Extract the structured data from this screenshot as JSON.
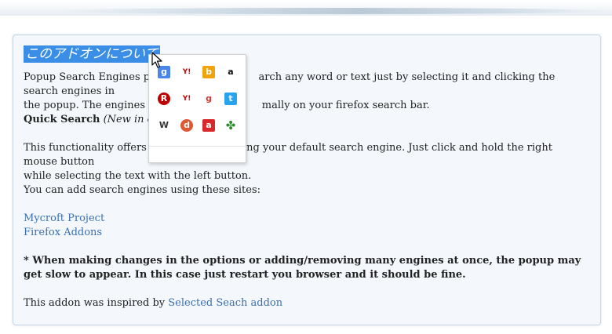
{
  "section_heading": "このアドオンについて",
  "intro_start": "Popup Search Engines prov",
  "intro_mid": "arch any word or text just by selecting it and clicking the search engines in",
  "intro_line2a": "the popup. The engines are",
  "intro_line2b": "mally on your firefox search bar.",
  "quick_search_label": "Quick Search",
  "quick_search_note": "(New in o.2",
  "quick_desc_a": "This functionality offers a q",
  "quick_desc_b": "ng your default search engine. Just click and hold the right mouse button",
  "quick_desc_line2": "while selecting the text with the left button.",
  "add_engines_text": "You can add search engines using these sites:",
  "links": [
    "Mycroft Project",
    "Firefox Addons"
  ],
  "warning_text": "* When making changes in the options or adding/removing many engines at once, the popup may get slow to appear. In this case just restart you browser and it should be fine.",
  "inspired_prefix": "This addon was inspired by ",
  "inspired_link": "Selected Seach addon",
  "popup": {
    "engines": [
      {
        "name": "google",
        "glyph": "g",
        "fg": "#ffffff",
        "bg": "#4a86e8"
      },
      {
        "name": "yahoo",
        "glyph": "Y!",
        "fg": "#cc0000",
        "bg": "#ffffff"
      },
      {
        "name": "bing",
        "glyph": "b",
        "fg": "#ffffff",
        "bg": "#f0a30a"
      },
      {
        "name": "amazon",
        "glyph": "a",
        "fg": "#111111",
        "bg": "#ffffff"
      },
      {
        "name": "rakuten",
        "glyph": "R",
        "fg": "#ffffff",
        "bg": "#bf0000"
      },
      {
        "name": "yahoo-japan",
        "glyph": "Y!",
        "fg": "#cc0000",
        "bg": "#ffffff"
      },
      {
        "name": "goo",
        "glyph": "g",
        "fg": "#d23a3a",
        "bg": "#ffffff"
      },
      {
        "name": "twitter",
        "glyph": "t",
        "fg": "#ffffff",
        "bg": "#2aa3ef"
      },
      {
        "name": "wikipedia",
        "glyph": "W",
        "fg": "#333333",
        "bg": "#ffffff"
      },
      {
        "name": "duckduckgo",
        "glyph": "d",
        "fg": "#ffffff",
        "bg": "#de5833"
      },
      {
        "name": "kakaku",
        "glyph": "a",
        "fg": "#ffffff",
        "bg": "#d8282c"
      },
      {
        "name": "puzzle",
        "glyph": "✤",
        "fg": "#2e8b2e",
        "bg": "#ffffff"
      }
    ]
  }
}
